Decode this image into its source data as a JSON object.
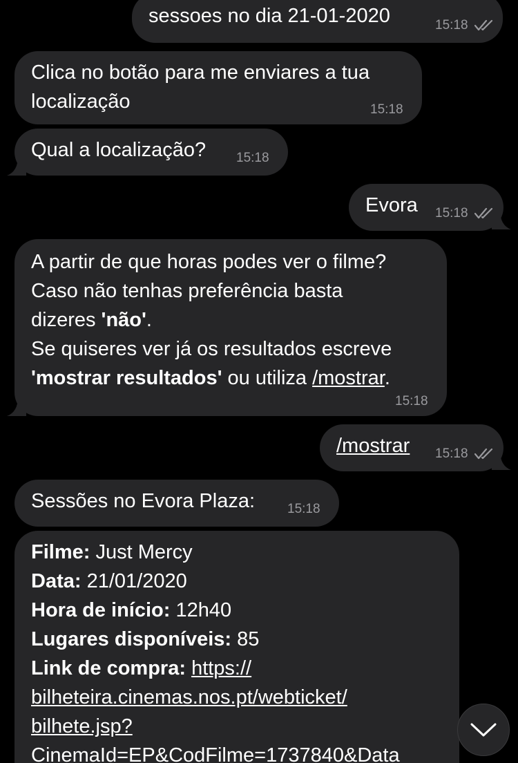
{
  "messages": [
    {
      "text": "sessoes no dia 21-01-2020",
      "time": "15:18"
    },
    {
      "line1": "Clica no botão para me enviares a tua",
      "line2": "localização",
      "time": "15:18"
    },
    {
      "text": "Qual a localização?",
      "time": "15:18"
    },
    {
      "text": "Evora",
      "time": "15:18"
    },
    {
      "l1": "A partir de que horas podes ver o filme?",
      "l2": "Caso não tenhas preferência basta",
      "l3a": "dizeres ",
      "l3b": "'não'",
      "l3c": ".",
      "l4": "Se quiseres ver já os resultados escreve",
      "l5a": "'mostrar resultados'",
      "l5b": " ou utiliza ",
      "l5c": "/mostrar",
      "l5d": ".",
      "time": "15:18"
    },
    {
      "text": "/mostrar",
      "time": "15:18"
    },
    {
      "text": "Sessões no Evora Plaza:",
      "time": "15:18"
    },
    {
      "film_label": "Filme:",
      "film_value": " Just Mercy",
      "date_label": "Data:",
      "date_value": " 21/01/2020",
      "start_label": "Hora de início:",
      "start_value": " 12h40",
      "seats_label": "Lugares disponíveis:",
      "seats_value": " 85",
      "link_label": "Link de compra:",
      "link_l1": "https://",
      "link_l2": "bilheteira.cinemas.nos.pt/webticket/",
      "link_l3": "bilhete.jsp?",
      "link_l4": "CinemaId=EP&CodFilme=1737840&Data"
    }
  ],
  "icons": {
    "read_ticks": "double-check-icon",
    "scroll_down": "chevron-down-icon"
  },
  "colors": {
    "background": "#000000",
    "bubble": "#262628",
    "time": "#9a9a9e"
  }
}
